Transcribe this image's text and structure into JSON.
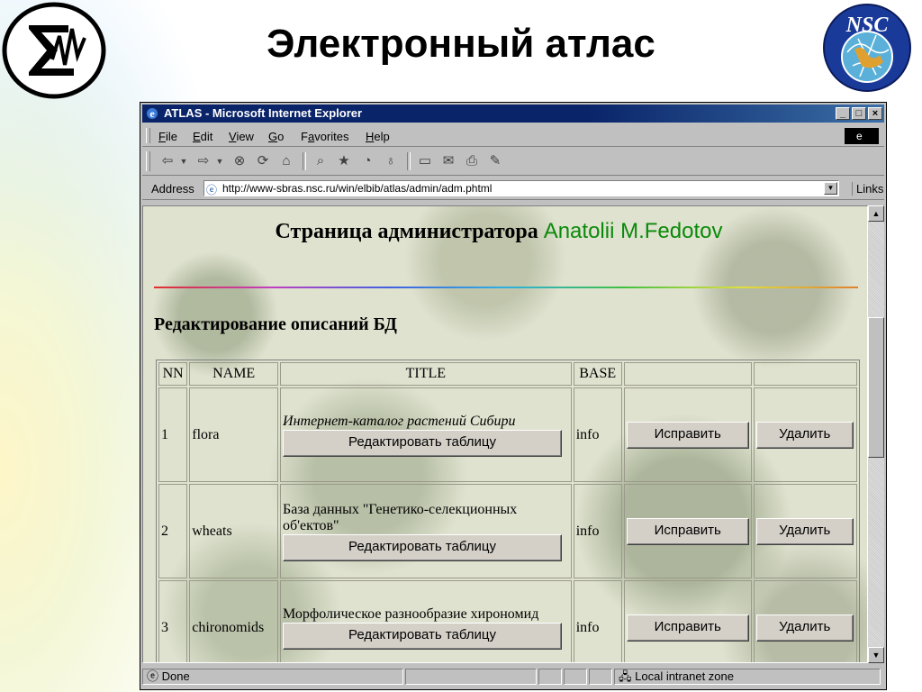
{
  "slide": {
    "title": "Электронный атлас",
    "logo_right_text": "NSC"
  },
  "window": {
    "title": "ATLAS - Microsoft Internet Explorer",
    "controls": {
      "minimize": "_",
      "maximize": "□",
      "close": "×"
    }
  },
  "menu": {
    "items": [
      {
        "accel": "F",
        "rest": "ile"
      },
      {
        "accel": "E",
        "rest": "dit"
      },
      {
        "accel": "V",
        "rest": "iew"
      },
      {
        "accel": "G",
        "rest": "o"
      },
      {
        "accel": "a",
        "pre": "F",
        "rest": "vorites"
      },
      {
        "accel": "H",
        "rest": "elp"
      }
    ]
  },
  "toolbar": {
    "icons": [
      "back-icon",
      "forward-icon",
      "stop-icon",
      "refresh-icon",
      "home-icon",
      "search-icon",
      "favorites-icon",
      "history-icon",
      "channels-icon",
      "fullscreen-icon",
      "mail-icon",
      "print-icon",
      "edit-icon"
    ]
  },
  "address": {
    "label": "Address",
    "url": "http://www-sbras.nsc.ru/win/elbib/atlas/admin/adm.phtml",
    "links_label": "Links"
  },
  "page": {
    "heading_prefix": "Страница администратора",
    "admin_name": "Anatolii M.Fedotov",
    "section_title": "Редактирование описаний БД",
    "table": {
      "headers": [
        "NN",
        "NAME",
        "TITLE",
        "BASE",
        "",
        ""
      ],
      "rows": [
        {
          "nn": "1",
          "name": "flora",
          "title": "Интернет-каталог растений Сибири",
          "title_italic": true,
          "edit_table_label": "Редактировать таблицу",
          "base": "info",
          "fix_label": "Исправить",
          "delete_label": "Удалить"
        },
        {
          "nn": "2",
          "name": "wheats",
          "title": "База данных \"Генетико-селекционных об'ектов\"",
          "title_italic": false,
          "edit_table_label": "Редактировать таблицу",
          "base": "info",
          "fix_label": "Исправить",
          "delete_label": "Удалить"
        },
        {
          "nn": "3",
          "name": "chironomids",
          "title": "Морфолическое разнообразие хирономид",
          "title_italic": false,
          "edit_table_label": "Редактировать таблицу",
          "base": "info",
          "fix_label": "Исправить",
          "delete_label": "Удалить"
        }
      ]
    }
  },
  "status": {
    "left_text": "Done",
    "zone_text": "Local intranet zone"
  },
  "colors": {
    "titlebar": "#0a246a",
    "admin_name": "#0a8a0a",
    "chrome": "#c0c0c0"
  }
}
